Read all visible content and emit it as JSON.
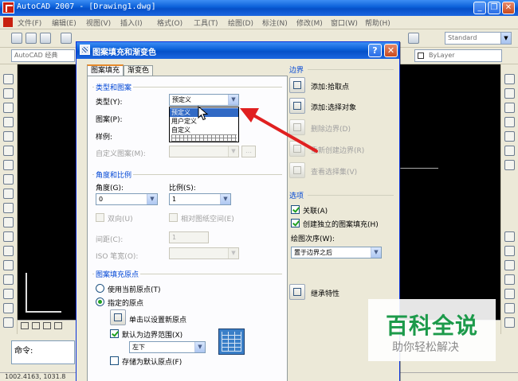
{
  "app": {
    "title": "AutoCAD 2007 - [Drawing1.dwg]",
    "menu": [
      "文件(F)",
      "编辑(E)",
      "视图(V)",
      "插入(I)",
      "格式(O)",
      "工具(T)",
      "绘图(D)",
      "标注(N)",
      "修改(M)",
      "窗口(W)",
      "帮助(H)"
    ],
    "style_combo": "Standard",
    "workspace_combo": "AutoCAD 经典",
    "layer_combo": "ByLayer",
    "command_prompt": "命令:",
    "coords": "1002.4163, 1031.8"
  },
  "dialog": {
    "title": "图案填充和渐变色",
    "tabs": [
      "图案填充",
      "渐变色"
    ],
    "type_pattern": {
      "group_title": "类型和图案",
      "type_label": "类型(Y):",
      "type_value": "预定义",
      "type_options": [
        "预定义",
        "用户定义",
        "自定义"
      ],
      "pattern_label": "图案(P):",
      "swatch_label": "样例:",
      "custom_label": "自定义图案(M):"
    },
    "angle_scale": {
      "group_title": "角度和比例",
      "angle_label": "角度(G):",
      "angle_value": "0",
      "scale_label": "比例(S):",
      "scale_value": "1",
      "double_label": "双向(U)",
      "relative_label": "相对图纸空间(E)",
      "spacing_label": "间距(C):",
      "spacing_value": "1",
      "iso_label": "ISO 笔宽(O):"
    },
    "origin": {
      "group_title": "图案填充原点",
      "use_current_label": "使用当前原点(T)",
      "specified_label": "指定的原点",
      "click_set_label": "单击以设置新原点",
      "default_extent_label": "默认为边界范围(X)",
      "default_extent_value": "左下",
      "store_default_label": "存储为默认原点(F)"
    },
    "boundaries": {
      "group_title": "边界",
      "add_pick_points": "添加:拾取点",
      "add_select_objects": "添加:选择对象",
      "remove_boundaries": "删除边界(D)",
      "recreate_boundary": "重新创建边界(R)",
      "view_selections": "查看选择集(V)"
    },
    "options": {
      "group_title": "选项",
      "associative_label": "关联(A)",
      "separate_label": "创建独立的图案填充(H)",
      "draw_order_label": "绘图次序(W):",
      "draw_order_value": "置于边界之后"
    },
    "inherit_label": "继承特性"
  },
  "watermark": {
    "title": "百科全说",
    "subtitle": "助你轻松解决"
  },
  "colors": {
    "titlebar": "#0a5fd8",
    "group_title": "#0046d5",
    "annotation_arrow": "#e02020",
    "watermark_green": "#1c9a4a"
  }
}
